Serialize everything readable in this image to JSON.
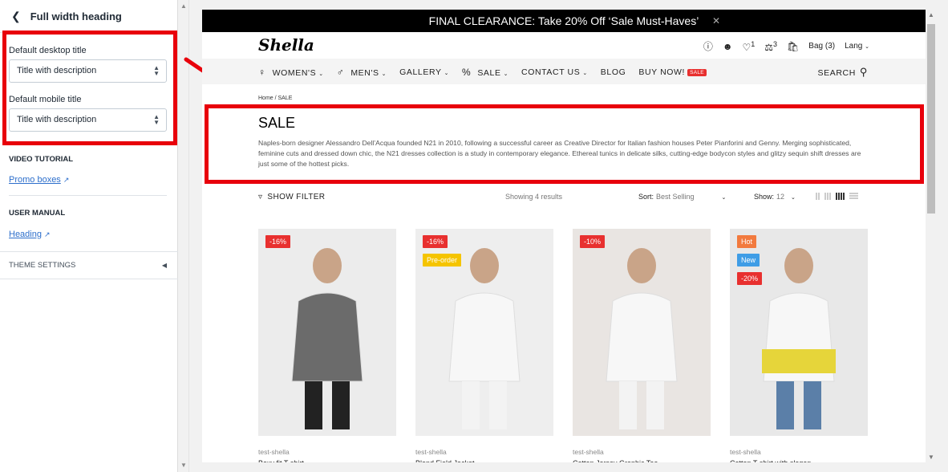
{
  "editor": {
    "title": "Full width heading",
    "desktop_label": "Default desktop title",
    "desktop_value": "Title with description",
    "mobile_label": "Default mobile title",
    "mobile_value": "Title with description",
    "video_tutorial": "VIDEO TUTORIAL",
    "video_link": "Promo boxes",
    "user_manual": "USER MANUAL",
    "manual_link": "Heading",
    "theme_settings": "THEME SETTINGS"
  },
  "store": {
    "announcement": "FINAL CLEARANCE: Take 20% Off ‘Sale Must-Haves’",
    "logo": "Shella",
    "wishlist_count": "1",
    "compare_count": "3",
    "bag": "Bag (3)",
    "lang": "Lang",
    "nav": [
      {
        "label": "WOMEN'S",
        "icon": "woman-icon",
        "dropdown": true
      },
      {
        "label": "MEN'S",
        "icon": "man-icon",
        "dropdown": true
      },
      {
        "label": "GALLERY",
        "icon": "",
        "dropdown": true
      },
      {
        "label": "SALE",
        "icon": "percent-icon",
        "dropdown": true
      },
      {
        "label": "CONTACT US",
        "icon": "",
        "dropdown": true
      },
      {
        "label": "BLOG",
        "icon": "",
        "dropdown": false
      },
      {
        "label": "BUY NOW!",
        "icon": "",
        "dropdown": false,
        "tag": "SALE"
      }
    ],
    "search": "SEARCH",
    "breadcrumb": "Home  /  SALE",
    "collection_title": "SALE",
    "collection_desc": "Naples-born designer Alessandro Dell’Acqua founded N21 in 2010, following a successful career as Creative Director for Italian fashion houses Peter Pianforini and Genny. Merging sophisticated, feminine cuts and dressed down chic, the N21 dresses collection is a study in contemporary elegance. Ethereal tunics in delicate silks, cutting-edge bodycon styles and glitzy sequin shift dresses are just some of the hottest picks.",
    "filter": "SHOW FILTER",
    "showing": "Showing 4 results",
    "sort_label": "Sort:",
    "sort_value": "Best Selling",
    "show_label": "Show:",
    "show_value": "12",
    "products": [
      {
        "vendor": "test-shella",
        "name": "Boxy fit T-shirt",
        "badges": [
          {
            "text": "-16%",
            "color": "#e8302f"
          }
        ],
        "bg": "#ececec"
      },
      {
        "vendor": "test-shella",
        "name": "Blend Field Jacket",
        "badges": [
          {
            "text": "-16%",
            "color": "#e8302f"
          },
          {
            "text": "Pre-order",
            "color": "#f5c400"
          }
        ],
        "bg": "#eeeeee"
      },
      {
        "vendor": "test-shella",
        "name": "Cotton Jersey Graphic Tee",
        "badges": [
          {
            "text": "-10%",
            "color": "#e8302f"
          }
        ],
        "bg": "#e9e5e2"
      },
      {
        "vendor": "test-shella",
        "name": "Cotton T-shirt with slogan",
        "badges": [
          {
            "text": "Hot",
            "color": "#f27a3e"
          },
          {
            "text": "New",
            "color": "#3f9de6"
          },
          {
            "text": "-20%",
            "color": "#e8302f"
          }
        ],
        "bg": "#e8e8e8"
      }
    ]
  },
  "accent": "#e8000b"
}
